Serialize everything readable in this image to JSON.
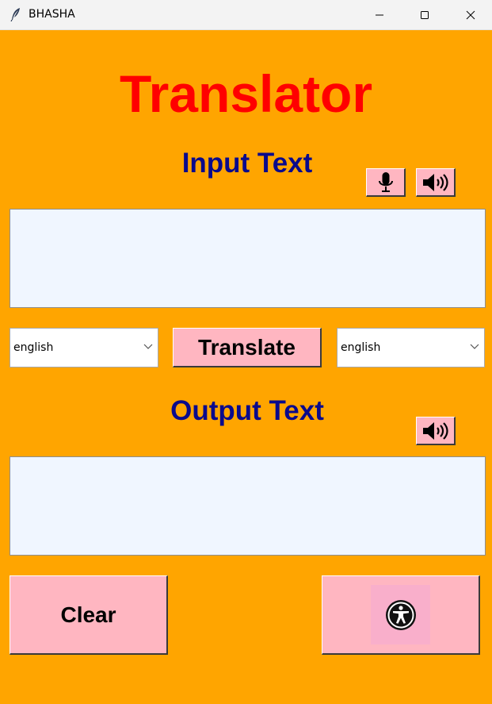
{
  "window": {
    "title": "BHASHA"
  },
  "app": {
    "title": "Translator"
  },
  "input": {
    "label": "Input Text",
    "value": "",
    "placeholder": ""
  },
  "output": {
    "label": "Output Text",
    "value": "",
    "placeholder": ""
  },
  "languages": {
    "source_selected": "english",
    "target_selected": "english"
  },
  "buttons": {
    "translate_label": "Translate",
    "clear_label": "Clear",
    "mic_icon": "microphone-icon",
    "speak_icon": "speaker-icon",
    "accessibility_icon": "accessibility-icon"
  },
  "colors": {
    "background": "#FFA500",
    "title": "#FF0000",
    "label": "#0A0A8C",
    "button": "#FFB6C1",
    "textbox": "#F0F6FF"
  }
}
